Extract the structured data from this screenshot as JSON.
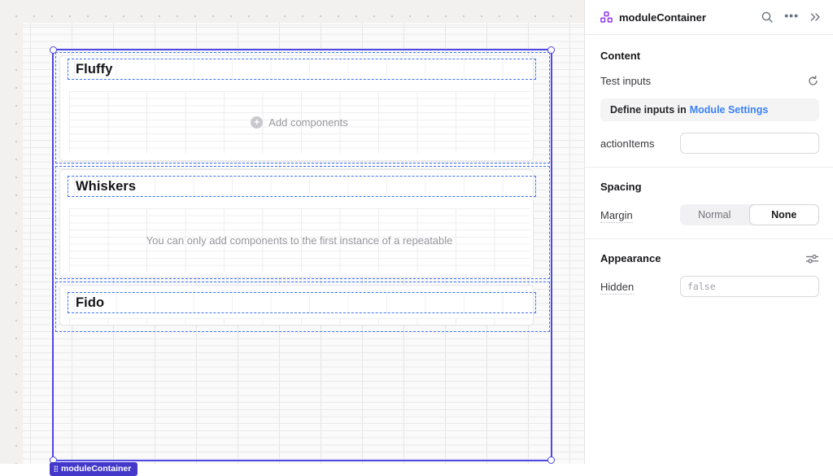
{
  "colors": {
    "selection_outline": "#4f46e5",
    "component_outline": "#3f74f6",
    "selection_tag_bg": "#4338ca",
    "link": "#3b82f6",
    "module_icon": "#9333ea"
  },
  "icons": {
    "more_glyph": "•••",
    "add_plus_glyph": "+"
  },
  "canvas": {
    "selection_tag": "moduleContainer",
    "instances": [
      {
        "title": "Fluffy",
        "body_text": "Add components"
      },
      {
        "title": "Whiskers",
        "body_text": "You can only add components to the first instance of a repeatable"
      },
      {
        "title": "Fido",
        "body_text": ""
      }
    ]
  },
  "inspector": {
    "title": "moduleContainer",
    "content": {
      "heading": "Content",
      "test_inputs_label": "Test inputs",
      "info_prefix": "Define inputs in",
      "info_link": "Module Settings",
      "action_items_label": "actionItems",
      "action_items_value": ""
    },
    "spacing": {
      "heading": "Spacing",
      "margin_label": "Margin",
      "option_normal": "Normal",
      "option_none": "None",
      "selected": "None"
    },
    "appearance": {
      "heading": "Appearance",
      "hidden_label": "Hidden",
      "hidden_placeholder": "false"
    }
  }
}
